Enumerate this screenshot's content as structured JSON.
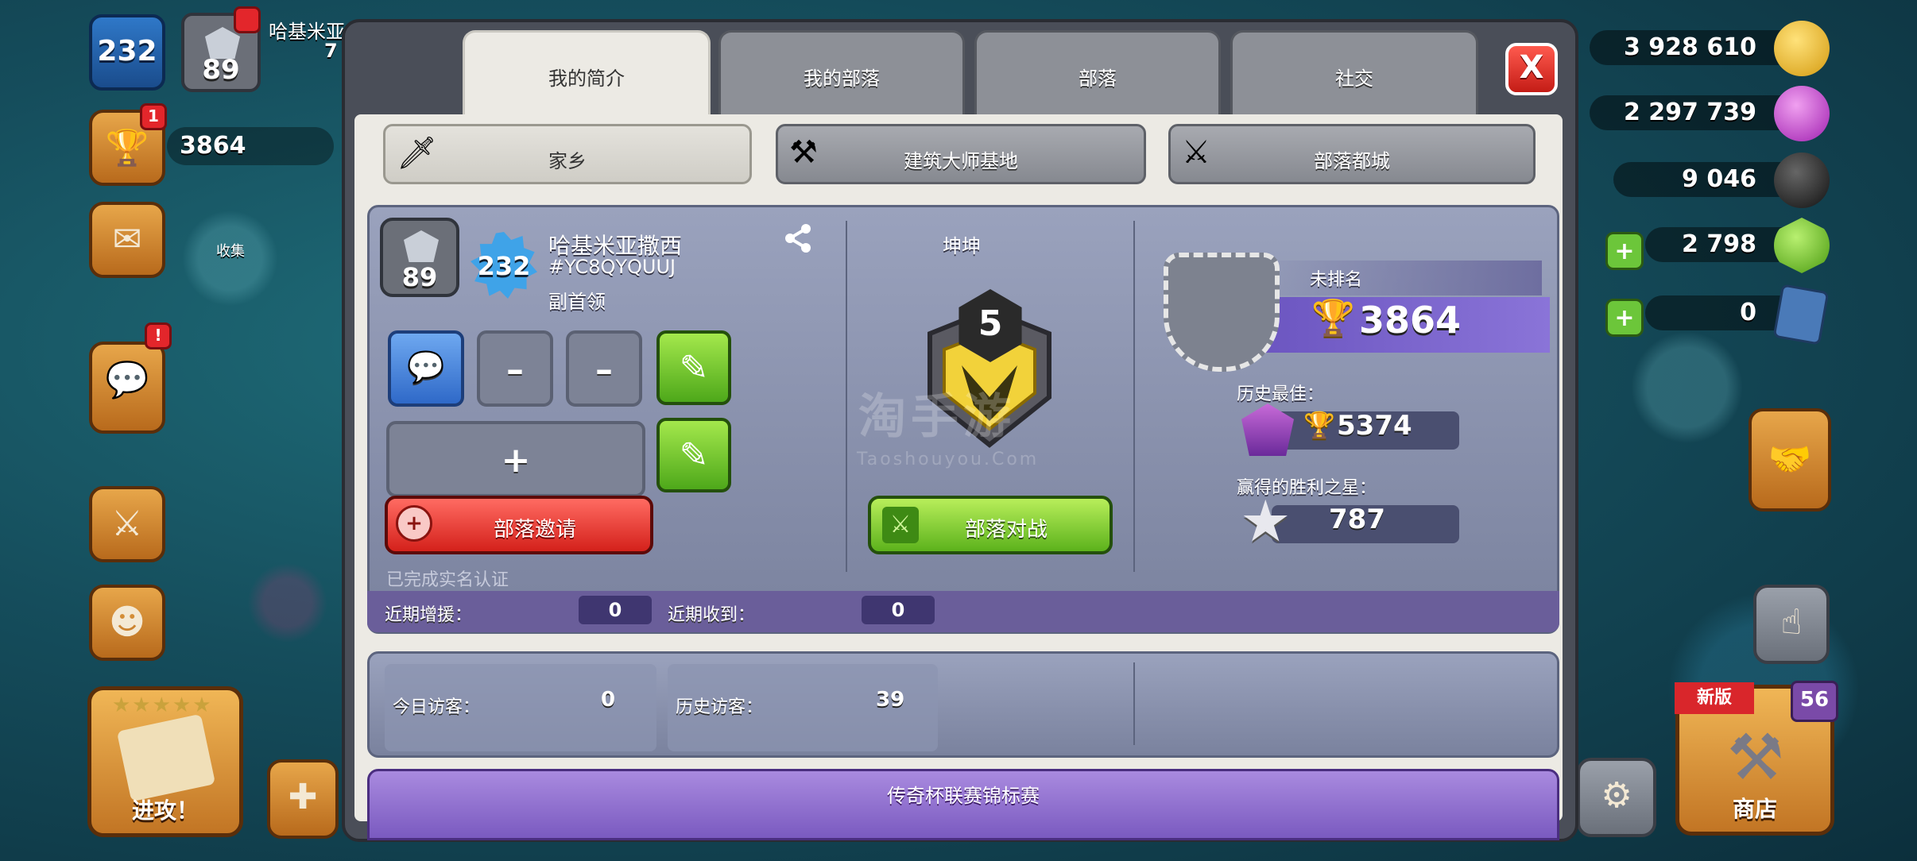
{
  "hud": {
    "xp_level": "232",
    "league_level": "89",
    "player_name_partial": "哈基米亚",
    "player_num_partial": "7",
    "trophies": "3864",
    "collect_label": "收集",
    "trophy_notification": "1",
    "chat_notification": "!",
    "attack_label": "进攻！",
    "shop_label": "商店",
    "shop_ribbon": "新版",
    "shop_badge": "56"
  },
  "resources": {
    "gold": "3 928 610",
    "elixir": "2 297 739",
    "dark_elixir": "9 046",
    "gems": "2 798",
    "tickets": "0"
  },
  "tabs": [
    "我的简介",
    "我的部落",
    "部落",
    "社交"
  ],
  "close_label": "X",
  "subtabs": [
    "家乡",
    "建筑大师基地",
    "部落都城"
  ],
  "profile": {
    "league_level": "89",
    "xp_level": "232",
    "name": "哈基米亚撒西",
    "tag": "#YC8QYQUUJ",
    "role": "副首领",
    "slot_dash_1": "–",
    "slot_dash_2": "–",
    "slot_plus": "+",
    "invite_label": "部落邀请",
    "verified_text": "已完成实名认证"
  },
  "clan": {
    "name": "坤坤",
    "level": "5",
    "war_label": "部落对战",
    "watermark": "淘手游",
    "watermark_url": "Taoshouyou.Com"
  },
  "rank": {
    "unranked_label": "未排名",
    "trophies": "3864",
    "best_label": "历史最佳：",
    "best_value": "5374",
    "stars_label": "赢得的胜利之星：",
    "stars_value": "787"
  },
  "recent": {
    "donated_label": "近期增援：",
    "donated_value": "0",
    "received_label": "近期收到：",
    "received_value": "0"
  },
  "visitors": {
    "today_label": "今日访客：",
    "today_value": "0",
    "history_label": "历史访客：",
    "history_value": "39"
  },
  "legend_title": "传奇杯联赛锦标赛",
  "colors": {
    "modal_bg": "#eceae4",
    "panel_bg": "#8d94b2",
    "invite_red": "#d4211b",
    "war_green": "#5cb21c",
    "trophy_bar": "#7a64cc"
  }
}
